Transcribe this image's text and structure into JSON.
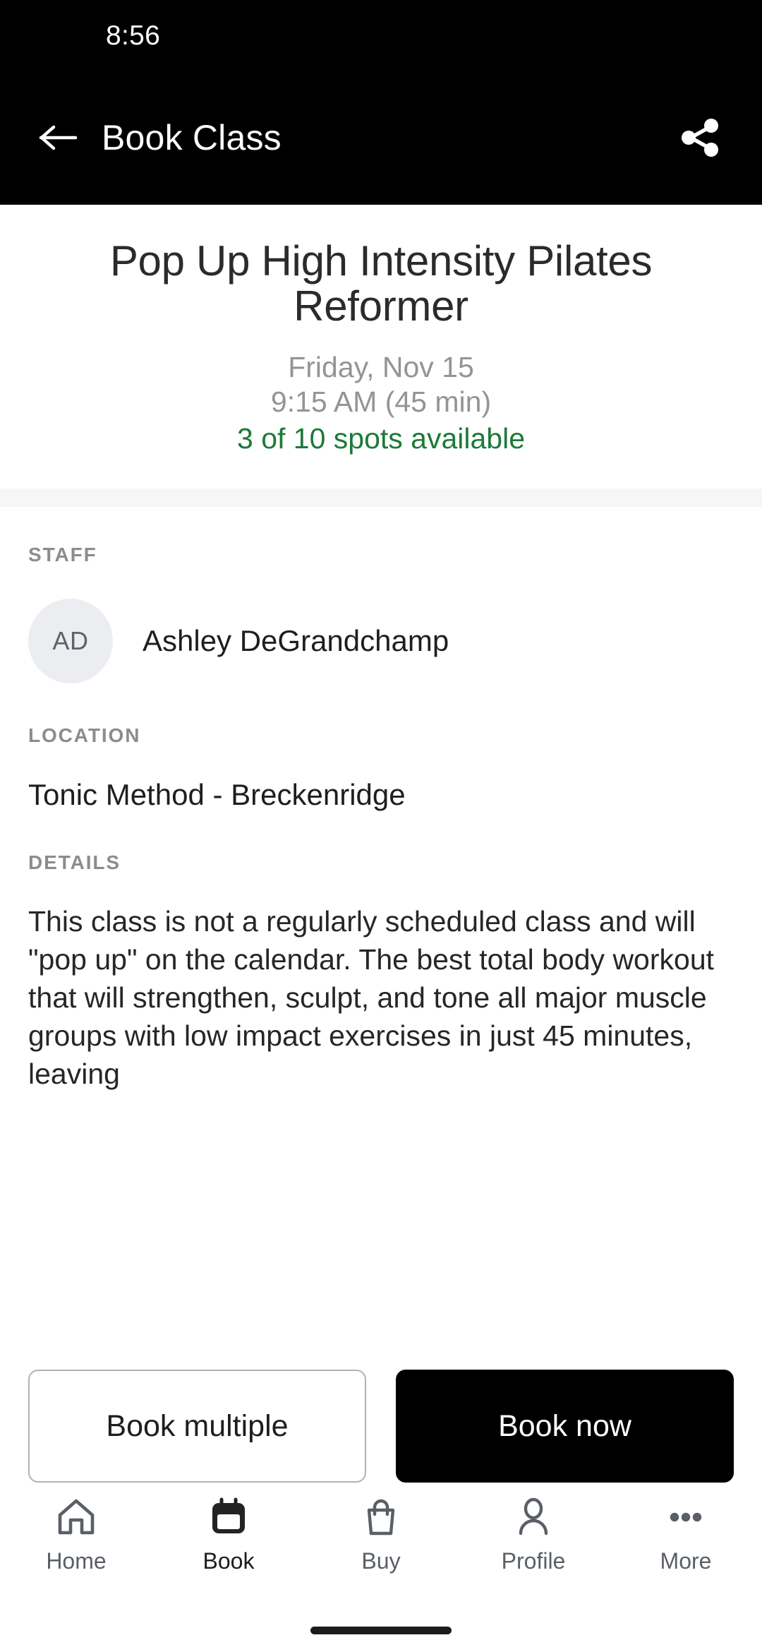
{
  "status_bar": {
    "time": "8:56"
  },
  "app_bar": {
    "title": "Book Class",
    "back_icon": "arrow-left-icon",
    "share_icon": "share-icon"
  },
  "hero": {
    "title": "Pop Up High Intensity Pilates Reformer",
    "date": "Friday, Nov 15",
    "time": "9:15 AM (45 min)",
    "spots": "3 of 10 spots available",
    "spots_color": "#1c7a38",
    "muted_color": "#949494"
  },
  "staff": {
    "label": "STAFF",
    "avatar_initials": "AD",
    "name": "Ashley DeGrandchamp"
  },
  "location": {
    "label": "LOCATION",
    "value": "Tonic Method - Breckenridge"
  },
  "details": {
    "label": "DETAILS",
    "body": "This class is not a regularly scheduled class and will \"pop up\" on the calendar. The best total body workout that will strengthen, sculpt, and tone all major muscle groups with low impact exercises in just 45 minutes, leaving"
  },
  "actions": {
    "secondary_label": "Book multiple",
    "primary_label": "Book now",
    "primary_bg": "#000000",
    "secondary_border": "#b2b2b2"
  },
  "bottom_nav": {
    "active_index": 1,
    "items": [
      {
        "label": "Home",
        "icon": "home-icon"
      },
      {
        "label": "Book",
        "icon": "calendar-icon"
      },
      {
        "label": "Buy",
        "icon": "shopping-bag-icon"
      },
      {
        "label": "Profile",
        "icon": "person-icon"
      },
      {
        "label": "More",
        "icon": "ellipsis-icon"
      }
    ]
  }
}
